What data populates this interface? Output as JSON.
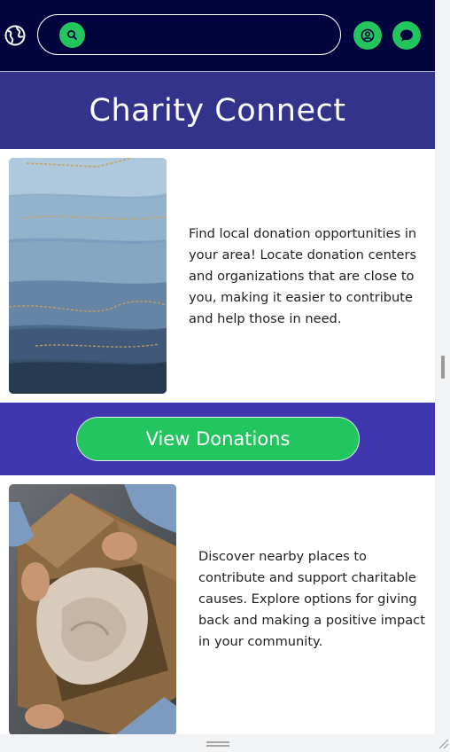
{
  "header": {
    "search_placeholder": "",
    "icons": {
      "globe": "globe-icon",
      "search": "search-icon",
      "account": "user-circle-icon",
      "chat": "chat-bubble-icon"
    }
  },
  "banner": {
    "title": "Charity Connect"
  },
  "card1": {
    "text": "Find local donation opportunities in your area! Locate donation centers and organizations that are close to you, making it easier to contribute and help those in need.",
    "image_desc": "folded-jeans-photo"
  },
  "action": {
    "button_label": "View Donations"
  },
  "card2": {
    "text": "Discover nearby places to contribute and support charitable causes. Explore options for giving back and making a positive impact in your community.",
    "image_desc": "clothes-donation-box-photo"
  },
  "colors": {
    "header_bg": "#03033e",
    "banner_bg": "#34338b",
    "action_bg": "#3f36b0",
    "accent_green": "#22c55e"
  }
}
